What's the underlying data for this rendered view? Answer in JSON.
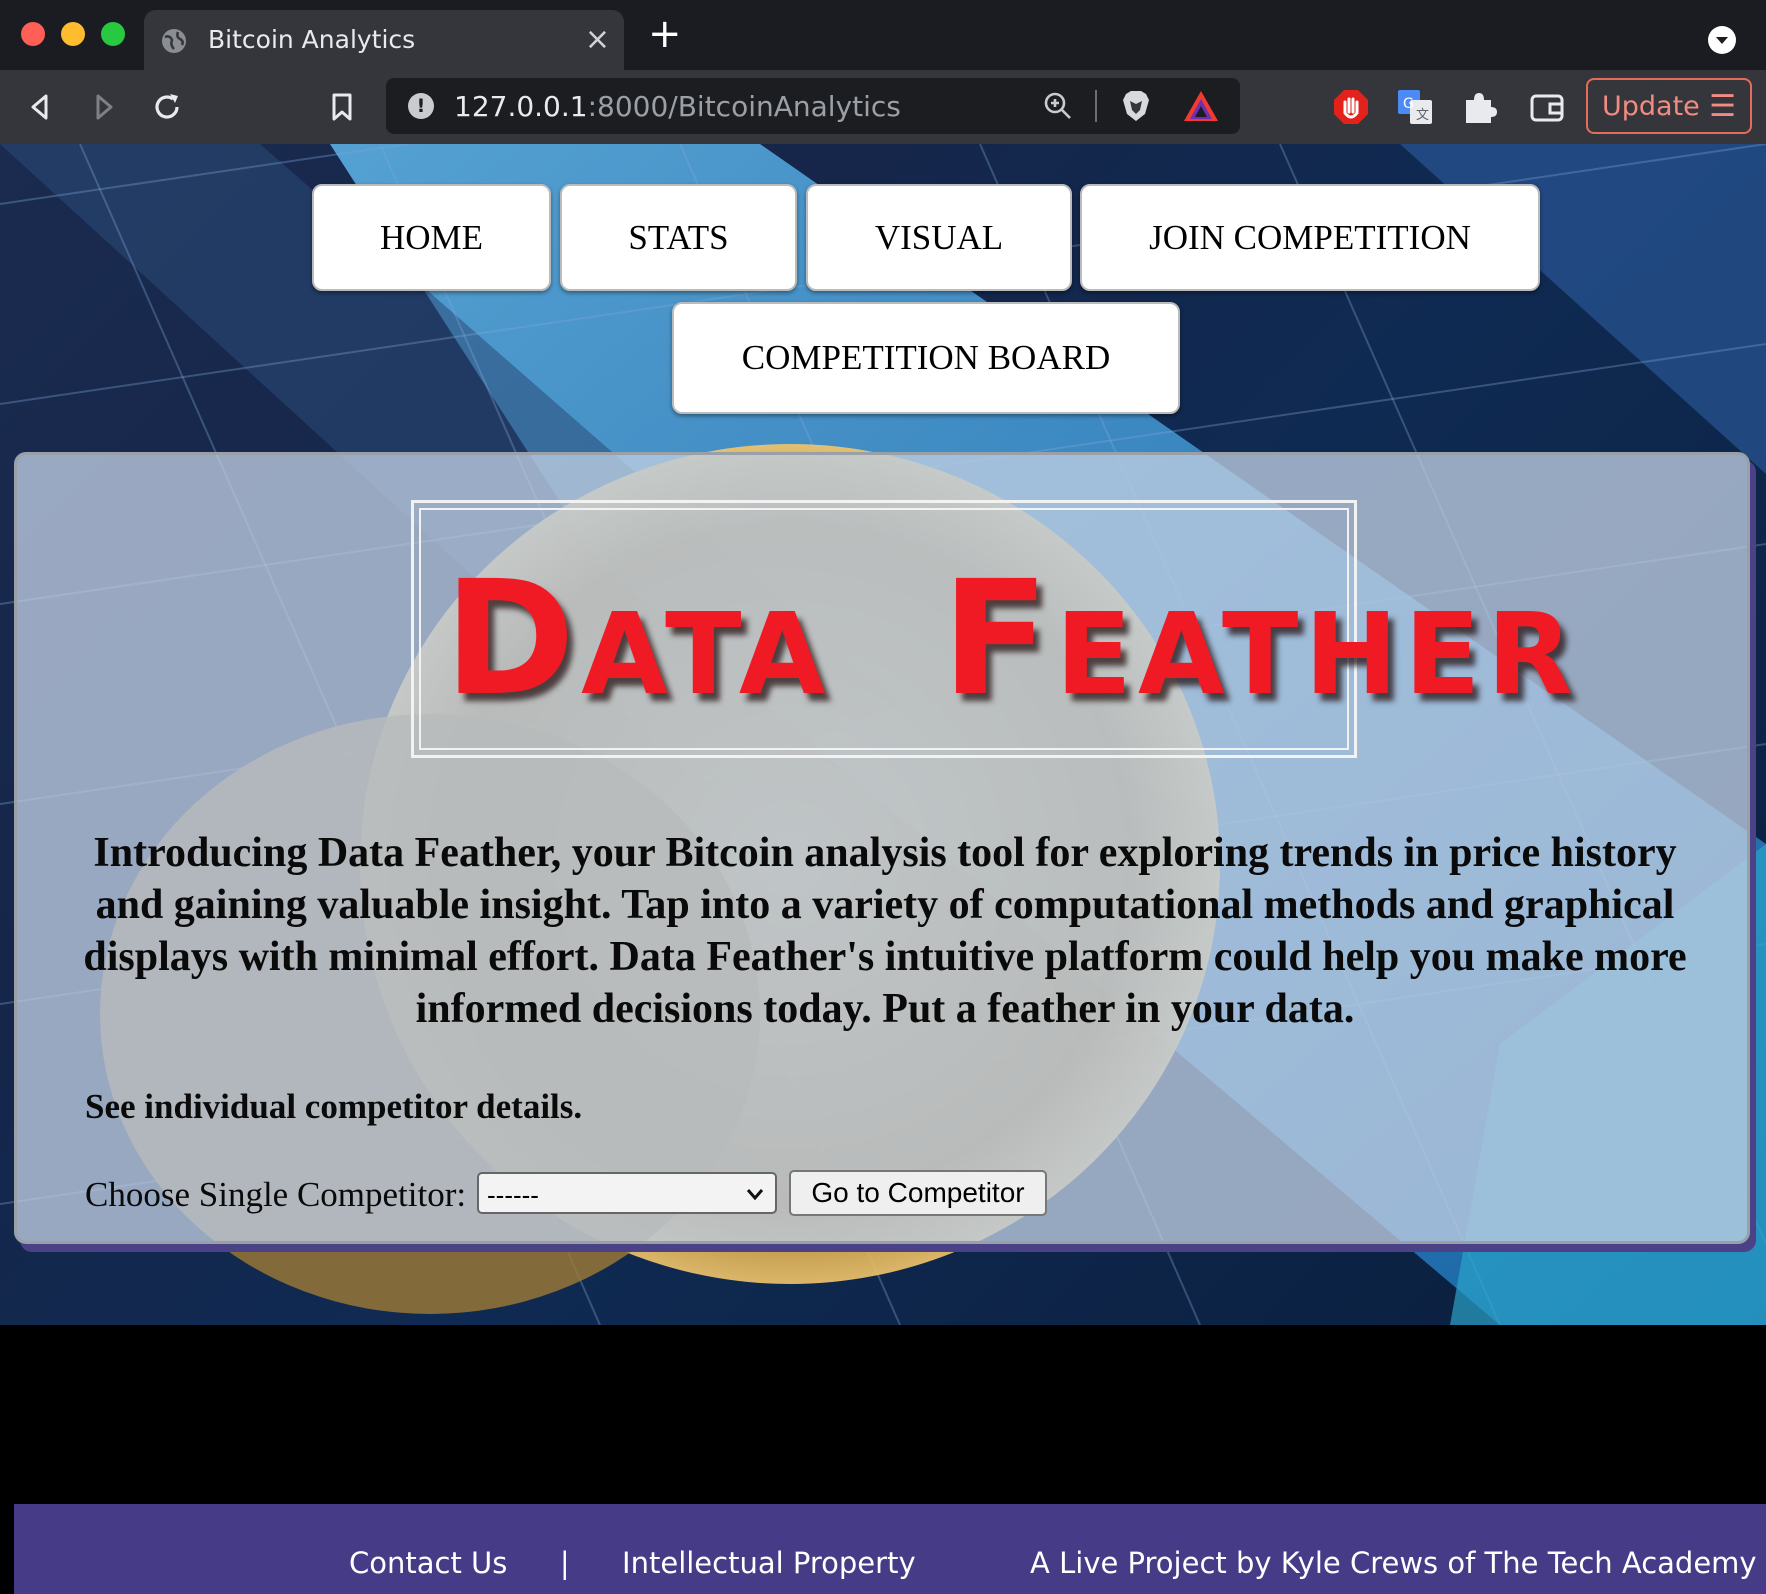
{
  "browser": {
    "tab_title": "Bitcoin Analytics",
    "tab_close": "×",
    "new_tab": "+",
    "url_host": "127.0.0.1",
    "url_rest": ":8000/BitcoinAnalytics",
    "update_label": "Update",
    "update_menu": "☰",
    "info_badge": "!"
  },
  "nav": {
    "home": "HOME",
    "stats": "STATS",
    "visual": "VISUAL",
    "join": "JOIN COMPETITION",
    "board": "COMPETITION BOARD"
  },
  "logo": {
    "word1_cap": "D",
    "word1_rest": "ATA",
    "word2_cap": "F",
    "word2_rest": "EATHER",
    "color": "#f01a24"
  },
  "main": {
    "intro": "Introducing Data Feather, your Bitcoin analysis tool for exploring trends in price history and gaining valuable insight. Tap into a variety of computational methods and graphical displays with minimal effort. Data Feather's intuitive platform could help you make more informed decisions today. Put a feather in your data.",
    "see_details": "See individual competitor details.",
    "choose_label": "Choose Single Competitor:",
    "select_value": "------",
    "go_button": "Go to Competitor"
  },
  "footer": {
    "contact": "Contact Us",
    "separator": "|",
    "ip": "Intellectual Property",
    "credit": "A Live Project by Kyle Crews of The Tech Academy",
    "color": "#463b87"
  }
}
